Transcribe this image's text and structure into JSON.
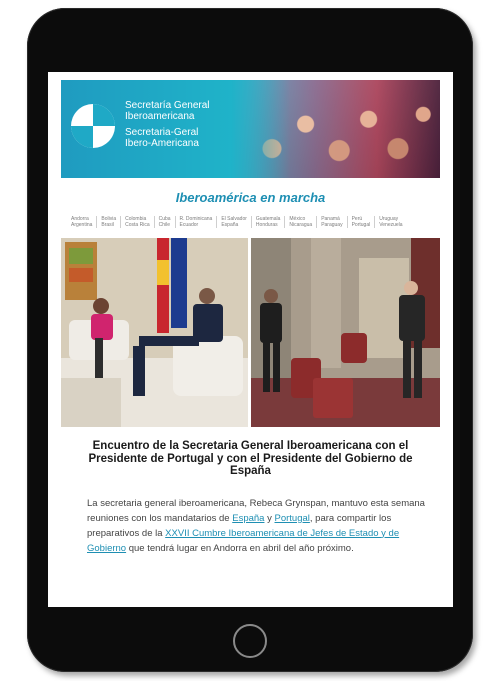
{
  "header": {
    "org_line1": "Secretaría General",
    "org_line2": "Iberoamericana",
    "org_line3": "Secretaria-Geral",
    "org_line4": "Ibero-Americana"
  },
  "section_title": "Iberoamérica en marcha",
  "countries": [
    [
      "Andorra",
      "Argentina"
    ],
    [
      "Bolivia",
      "Brasil"
    ],
    [
      "Colombia",
      "Costa Rica"
    ],
    [
      "Cuba",
      "Chile"
    ],
    [
      "R. Dominicana",
      "Ecuador"
    ],
    [
      "El Salvador",
      "España"
    ],
    [
      "Guatemala",
      "Honduras"
    ],
    [
      "México",
      "Nicaragua"
    ],
    [
      "Panamá",
      "Paraguay"
    ],
    [
      "Perú",
      "Portugal"
    ],
    [
      "Uruguay",
      "Venezuela"
    ]
  ],
  "article": {
    "title": "Encuentro de la Secretaria General Iberoamericana con el Presidente de Portugal y con el Presidente del Gobierno de España",
    "body_1": "La secretaria general iberoamericana, Rebeca Grynspan, mantuvo esta semana reuniones con los mandatarios de ",
    "link_spain": "España",
    "body_2": " y ",
    "link_portugal": "Portugal",
    "body_3": ", para compartir los preparativos de la ",
    "link_summit": "XXVII Cumbre Iberoamericana de Jefes de Estado y de Gobierno",
    "body_4": " que tendrá lugar en Andorra en abril del año próximo."
  },
  "colors": {
    "brand_teal": "#1e8fb3",
    "device_frame": "#0c0c0c"
  },
  "icons": {
    "logo": "sgi-logo-icon",
    "home": "home-button-icon"
  }
}
